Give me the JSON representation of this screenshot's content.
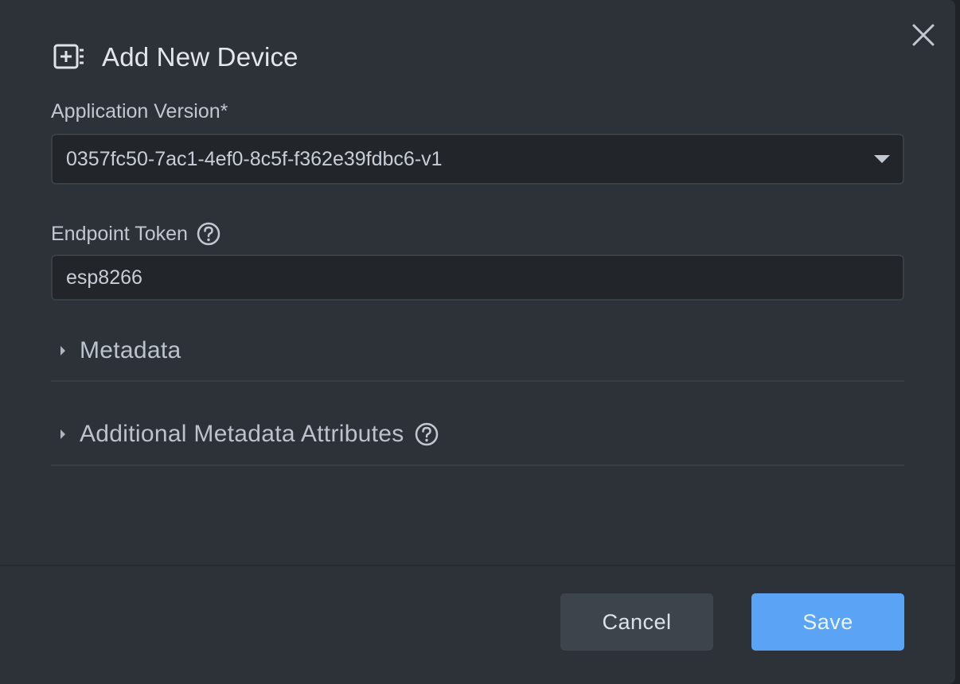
{
  "dialog": {
    "title": "Add New Device",
    "icon": "add-device-icon",
    "close_icon": "close-icon"
  },
  "application_version": {
    "label": "Application Version*",
    "value": "0357fc50-7ac1-4ef0-8c5f-f362e39fdbc6-v1"
  },
  "endpoint_token": {
    "label": "Endpoint Token",
    "help_icon": "help-circle-icon",
    "value": "esp8266"
  },
  "sections": [
    {
      "label": "Metadata",
      "icon": "caret-right-icon"
    },
    {
      "label": "Additional Metadata Attributes",
      "icon": "caret-right-icon",
      "help_icon": "help-circle-icon"
    }
  ],
  "footer": {
    "cancel_label": "Cancel",
    "save_label": "Save"
  },
  "colors": {
    "dialog_bg": "#2d3138",
    "field_bg": "#22252a",
    "primary": "#5aa3f5",
    "secondary_button": "#3e444c"
  }
}
